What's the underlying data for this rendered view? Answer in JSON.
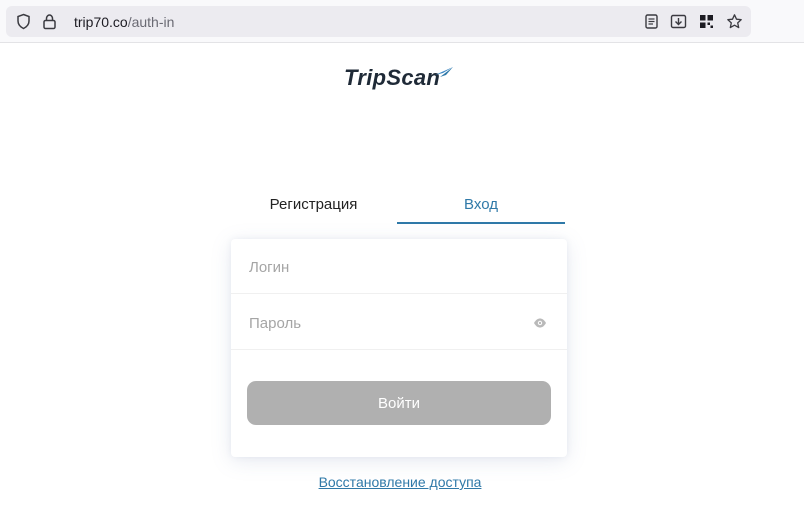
{
  "browser": {
    "url_host": "trip70.co",
    "url_path": "/auth-in",
    "icons": [
      "shield-icon",
      "lock-icon",
      "reader-view-icon",
      "download-icon",
      "qr-code-icon",
      "star-icon"
    ]
  },
  "logo": {
    "text": "TripScan"
  },
  "tabs": [
    {
      "label": "Регистрация",
      "active": false
    },
    {
      "label": "Вход",
      "active": true
    }
  ],
  "form": {
    "login_placeholder": "Логин",
    "password_placeholder": "Пароль",
    "submit_label": "Войти"
  },
  "restore_link": "Восстановление доступа",
  "colors": {
    "accent": "#2f79a8",
    "button_disabled": "#b0b0b0"
  }
}
